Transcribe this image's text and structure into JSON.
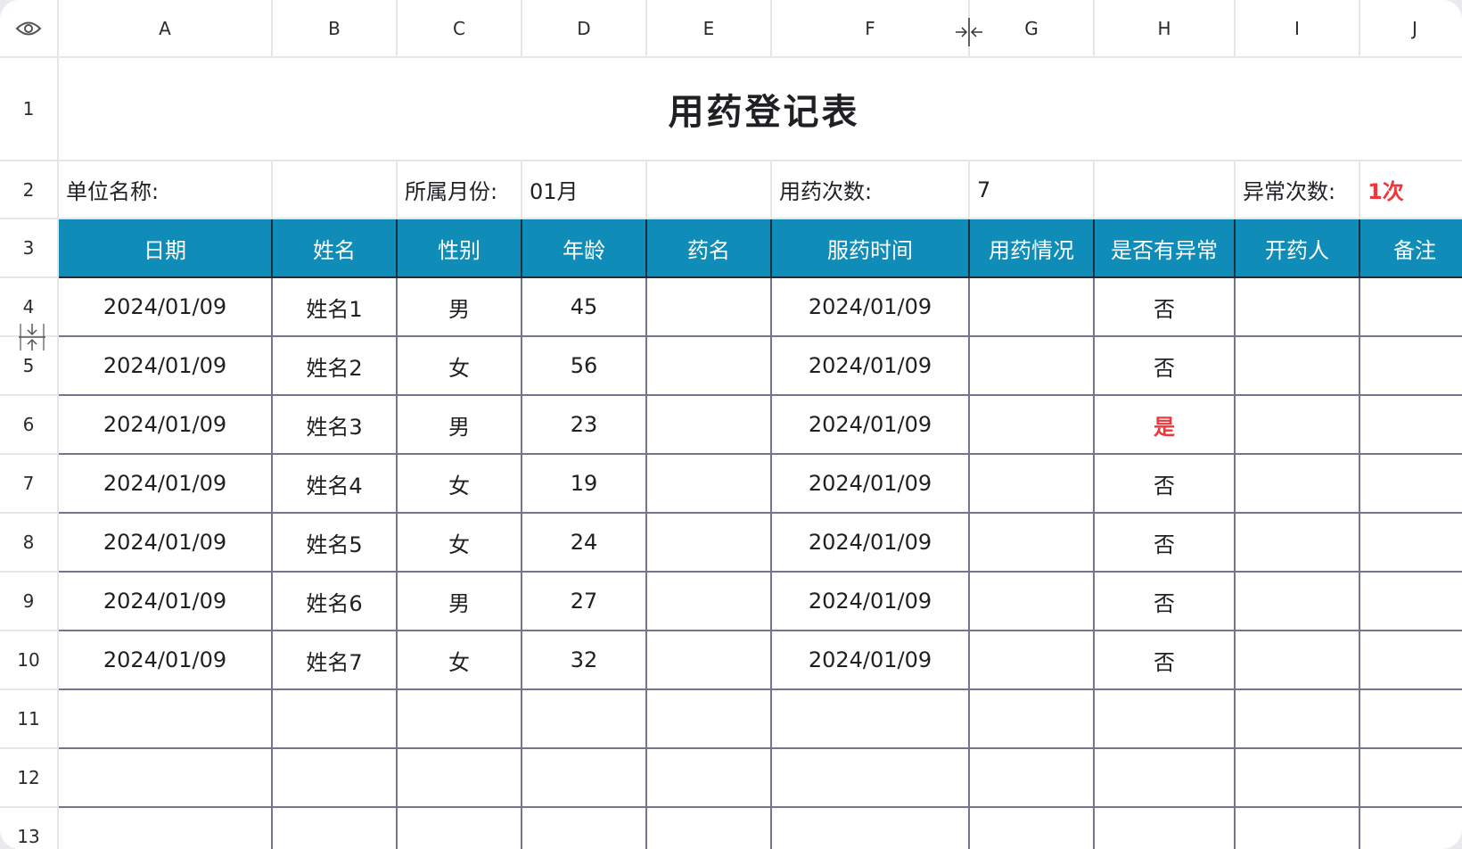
{
  "column_headers": [
    "A",
    "B",
    "C",
    "D",
    "E",
    "F",
    "G",
    "H",
    "I",
    "J"
  ],
  "row_numbers": [
    "1",
    "2",
    "3",
    "4",
    "5",
    "6",
    "7",
    "8",
    "9",
    "10",
    "11",
    "12",
    "13"
  ],
  "title": "用药登记表",
  "info_row": {
    "unit_label": "单位名称:",
    "unit_value": "",
    "month_label": "所属月份:",
    "month_value": "01月",
    "count_label": "用药次数:",
    "count_value": "7",
    "abnormal_label": "异常次数:",
    "abnormal_value": "1次"
  },
  "table_headers": [
    "日期",
    "姓名",
    "性别",
    "年龄",
    "药名",
    "服药时间",
    "用药情况",
    "是否有异常",
    "开药人",
    "备注"
  ],
  "rows": [
    {
      "date": "2024/01/09",
      "name": "姓名1",
      "gender": "男",
      "age": "45",
      "drug": "",
      "time": "2024/01/09",
      "status": "",
      "abnormal": "否",
      "prescriber": "",
      "note": ""
    },
    {
      "date": "2024/01/09",
      "name": "姓名2",
      "gender": "女",
      "age": "56",
      "drug": "",
      "time": "2024/01/09",
      "status": "",
      "abnormal": "否",
      "prescriber": "",
      "note": ""
    },
    {
      "date": "2024/01/09",
      "name": "姓名3",
      "gender": "男",
      "age": "23",
      "drug": "",
      "time": "2024/01/09",
      "status": "",
      "abnormal": "是",
      "prescriber": "",
      "note": ""
    },
    {
      "date": "2024/01/09",
      "name": "姓名4",
      "gender": "女",
      "age": "19",
      "drug": "",
      "time": "2024/01/09",
      "status": "",
      "abnormal": "否",
      "prescriber": "",
      "note": ""
    },
    {
      "date": "2024/01/09",
      "name": "姓名5",
      "gender": "女",
      "age": "24",
      "drug": "",
      "time": "2024/01/09",
      "status": "",
      "abnormal": "否",
      "prescriber": "",
      "note": ""
    },
    {
      "date": "2024/01/09",
      "name": "姓名6",
      "gender": "男",
      "age": "27",
      "drug": "",
      "time": "2024/01/09",
      "status": "",
      "abnormal": "否",
      "prescriber": "",
      "note": ""
    },
    {
      "date": "2024/01/09",
      "name": "姓名7",
      "gender": "女",
      "age": "32",
      "drug": "",
      "time": "2024/01/09",
      "status": "",
      "abnormal": "否",
      "prescriber": "",
      "note": ""
    }
  ],
  "empty_rows": 3,
  "colors": {
    "header_fill": "#0f8cb8",
    "header_text": "#ffffff",
    "alert_text": "#f0363b",
    "grid_line": "#74748c"
  },
  "icons": {
    "corner": "eye-icon",
    "column_resize": "column-resize-icon",
    "row_resize": "row-resize-icon"
  }
}
